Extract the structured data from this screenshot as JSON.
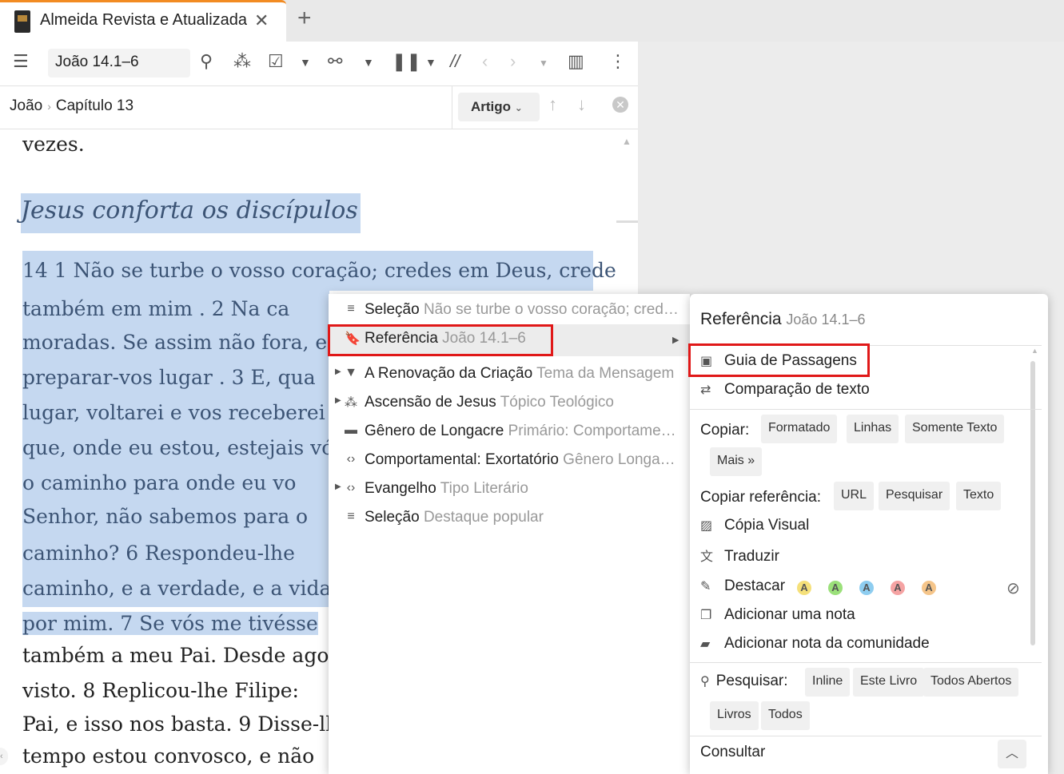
{
  "tab": {
    "title": "Almeida Revista e Atualizada",
    "close": "✕",
    "new_tab": "+"
  },
  "toolbar": {
    "reference": "João 14.1–6",
    "parallel": "//"
  },
  "nav": {
    "book": "João",
    "separator": "›",
    "chapter": "Capítulo 13",
    "artigo": "Artigo"
  },
  "content": {
    "lines": [
      "vezes.",
      "Jesus conforta os discípulos",
      "14 1 Não se turbe o vosso coração; credes em Deus, crede",
      "também em mim . 2 Na ca",
      "moradas. Se assim não fora, e",
      "preparar-vos lugar . 3 E, qua",
      "lugar, voltarei e vos receberei",
      "que, onde eu estou, estejais vó",
      "o caminho para onde eu vo",
      "Senhor, não sabemos para o",
      "caminho? 6 Respondeu-lhe",
      "caminho, e a verdade, e a vida;",
      "por mim. 7 Se vós me tivésse",
      "também a meu Pai. Desde ago",
      "visto. 8 Replicou-lhe Filipe:",
      "Pai, e isso nos basta. 9 Disse-lhe",
      "tempo estou convosco, e não"
    ]
  },
  "menu": {
    "items": [
      {
        "label": "Seleção",
        "sub": "Não se turbe o vosso coração; cred…"
      },
      {
        "label": "Referência",
        "sub": "João 14.1–6"
      },
      {
        "label": "A Renovação da Criação",
        "sub": "Tema da Mensagem"
      },
      {
        "label": "Ascensão de Jesus",
        "sub": "Tópico Teológico"
      },
      {
        "label": "Gênero de Longacre",
        "sub": "Primário: Comportame…"
      },
      {
        "label": "Comportamental: Exortatório",
        "sub": "Gênero Longa…"
      },
      {
        "label": "Evangelho",
        "sub": "Tipo Literário"
      },
      {
        "label": "Seleção",
        "sub": "Destaque popular"
      }
    ]
  },
  "submenu": {
    "title": "Referência",
    "title_sub": "João 14.1–6",
    "guia": "Guia de Passagens",
    "comparacao": "Comparação de texto",
    "copiar_label": "Copiar:",
    "copiar_chips": [
      "Formatado",
      "Linhas",
      "Somente Texto",
      "Mais »"
    ],
    "copiar_ref_label": "Copiar referência:",
    "copiar_ref_chips": [
      "URL",
      "Pesquisar",
      "Texto"
    ],
    "copia_visual": "Cópia Visual",
    "traduzir": "Traduzir",
    "destacar": "Destacar",
    "swatch_letter": "A",
    "swatch_colors": [
      "#f5e07a",
      "#9be07a",
      "#8ecdf0",
      "#f5a3a3",
      "#f5c58a"
    ],
    "adicionar_nota": "Adicionar uma nota",
    "nota_comunidade": "Adicionar nota da comunidade",
    "pesquisar_label": "Pesquisar:",
    "pesquisar_chips": [
      "Inline",
      "Este Livro",
      "Todos Abertos",
      "Livros",
      "Todos"
    ],
    "consultar": "Consultar"
  },
  "colors": {
    "accent": "#f28b22",
    "highlight_red": "#e01818",
    "verse_blue": "#3c5475",
    "selection": "#c5d8f0"
  }
}
